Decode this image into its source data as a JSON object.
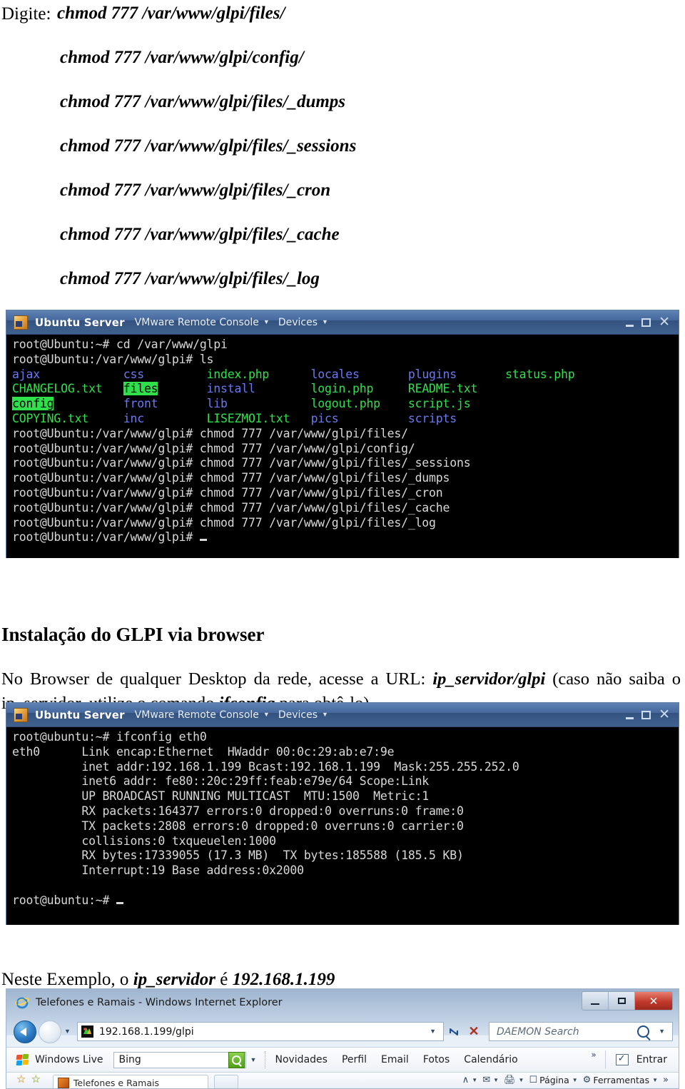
{
  "commands": {
    "lead_label": "Digite:",
    "lines": [
      "chmod 777 /var/www/glpi/files/",
      "chmod 777 /var/www/glpi/config/",
      "chmod 777 /var/www/glpi/files/_dumps",
      "chmod 777 /var/www/glpi/files/_sessions",
      "chmod 777 /var/www/glpi/files/_cron",
      "chmod 777 /var/www/glpi/files/_cache",
      "chmod 777 /var/www/glpi/files/_log"
    ]
  },
  "vm_window": {
    "app_title": "Ubuntu Server",
    "menu_console": "VMware Remote Console",
    "menu_devices": "Devices",
    "caret_glyph": "▼",
    "close_glyph": "✕"
  },
  "terminal_top": {
    "prompt_home": "root@Ubuntu:~#",
    "prompt_glpi": "root@Ubuntu:/var/www/glpi#",
    "cmd_cd": " cd /var/www/glpi",
    "cmd_ls": " ls",
    "ls_rows": [
      [
        {
          "text": "ajax",
          "style": "blue",
          "pad": 16
        },
        {
          "text": "css",
          "style": "blue",
          "pad": 12
        },
        {
          "text": "index.php",
          "style": "green",
          "pad": 15
        },
        {
          "text": "locales",
          "style": "blue",
          "pad": 14
        },
        {
          "text": "plugins",
          "style": "blue",
          "pad": 14
        },
        {
          "text": "status.php",
          "style": "green",
          "pad": 0
        }
      ],
      [
        {
          "text": "CHANGELOG.txt",
          "style": "green",
          "pad": 16
        },
        {
          "text": "files",
          "style": "hl",
          "pad": 12
        },
        {
          "text": "install",
          "style": "blue",
          "pad": 15
        },
        {
          "text": "login.php",
          "style": "green",
          "pad": 14
        },
        {
          "text": "README.txt",
          "style": "green",
          "pad": 0
        }
      ],
      [
        {
          "text": "config",
          "style": "hl",
          "pad": 16
        },
        {
          "text": "front",
          "style": "blue",
          "pad": 12
        },
        {
          "text": "lib",
          "style": "blue",
          "pad": 15
        },
        {
          "text": "logout.php",
          "style": "green",
          "pad": 14
        },
        {
          "text": "script.js",
          "style": "green",
          "pad": 0
        }
      ],
      [
        {
          "text": "COPYING.txt",
          "style": "green",
          "pad": 16
        },
        {
          "text": "inc",
          "style": "blue",
          "pad": 12
        },
        {
          "text": "LISEZMOI.txt",
          "style": "green",
          "pad": 15
        },
        {
          "text": "pics",
          "style": "blue",
          "pad": 14
        },
        {
          "text": "scripts",
          "style": "blue",
          "pad": 0
        }
      ]
    ],
    "chmod_commands": [
      " chmod 777 /var/www/glpi/files/",
      " chmod 777 /var/www/glpi/config/",
      " chmod 777 /var/www/glpi/files/_sessions",
      " chmod 777 /var/www/glpi/files/_dumps",
      " chmod 777 /var/www/glpi/files/_cron",
      " chmod 777 /var/www/glpi/files/_cache",
      " chmod 777 /var/www/glpi/files/_log"
    ]
  },
  "section": {
    "heading": "Instalação do GLPI via browser",
    "par_before": "No Browser de qualquer Desktop da rede, acesse a URL: ",
    "par_url": "ip_servidor/glpi",
    "par_middle": " (caso não saiba o ip_servidor, utilize o comando ",
    "par_cmd": "ifconfig",
    "par_after": " para obtê-lo)"
  },
  "terminal_bottom": {
    "prompt": "root@ubuntu:~#",
    "cmd": " ifconfig eth0",
    "lines": [
      "eth0      Link encap:Ethernet  HWaddr 00:0c:29:ab:e7:9e",
      "          inet addr:192.168.1.199 Bcast:192.168.1.199  Mask:255.255.252.0",
      "          inet6 addr: fe80::20c:29ff:feab:e79e/64 Scope:Link",
      "          UP BROADCAST RUNNING MULTICAST  MTU:1500  Metric:1",
      "          RX packets:164377 errors:0 dropped:0 overruns:0 frame:0",
      "          TX packets:2808 errors:0 dropped:0 overruns:0 carrier:0",
      "          collisions:0 txqueuelen:1000",
      "          RX bytes:17339055 (17.3 MB)  TX bytes:185588 (185.5 KB)",
      "          Interrupt:19 Base address:0x2000"
    ]
  },
  "example": {
    "before": "Neste Exemplo, o ",
    "term": "ip_servidor",
    "middle": " é ",
    "ip": "192.168.1.199"
  },
  "ie": {
    "title": "Telefones e Ramais - Windows Internet Explorer",
    "minimize_glyph": "",
    "maximize_glyph": "",
    "close_glyph": "✕",
    "address_value": "192.168.1.199/glpi",
    "address_caret": "▼",
    "refresh_glyph": "↻",
    "stop_glyph": "✕",
    "search_placeholder": "DAEMON Search",
    "search_caret": "▼",
    "live_brand": "Windows Live",
    "live_search_value": "Bing",
    "live_caret": "▼",
    "live_links": [
      "Novidades",
      "Perfil",
      "Email",
      "Fotos",
      "Calendário"
    ],
    "live_overflow": "»",
    "live_signin": "Entrar",
    "tab_title": "Telefones e Ramais",
    "cmd_page": "Página",
    "cmd_tools": "Ferramentas",
    "cmd_overflow": "»",
    "cmd_caret": "▼"
  },
  "colors": {
    "terminal_bg": "#000000",
    "dir_blue": "#6a79f0",
    "file_green": "#2fe04a",
    "highlight_green": "#2fe04a",
    "title_blue": "#45689e",
    "ie_close_red": "#c0392b"
  }
}
